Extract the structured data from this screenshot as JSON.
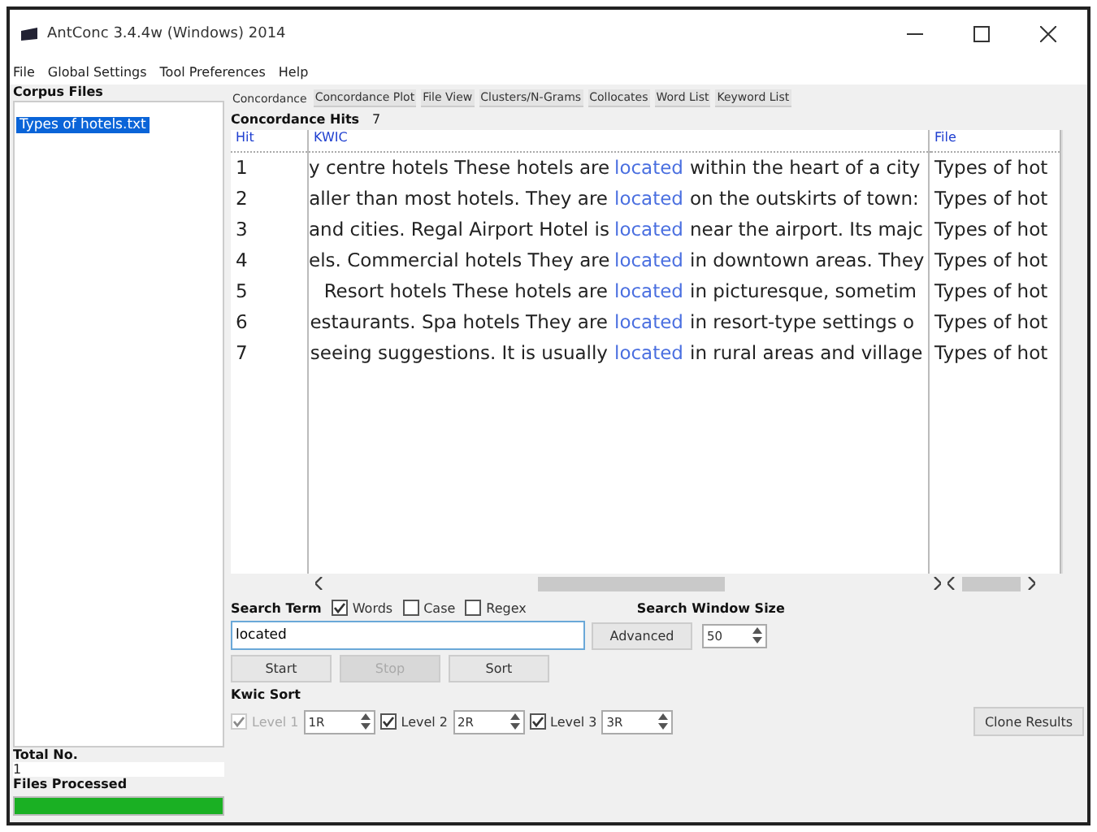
{
  "window": {
    "title": "AntConc 3.4.4w (Windows) 2014"
  },
  "menu": [
    "File",
    "Global Settings",
    "Tool Preferences",
    "Help"
  ],
  "corpus": {
    "heading": "Corpus Files",
    "files": [
      {
        "name": "Types of hotels.txt",
        "selected": true
      }
    ],
    "total_label": "Total No.",
    "total": "1",
    "processed_label": "Files Processed",
    "level": 1
  },
  "tabs": [
    {
      "label": "Concordance",
      "selected": true
    },
    {
      "label": "Concordance Plot",
      "selected": false
    },
    {
      "label": "File View",
      "selected": false
    },
    {
      "label": "Clusters/N-Grams",
      "selected": false
    },
    {
      "label": "Collocates",
      "selected": false
    },
    {
      "label": "Word List",
      "selected": false
    },
    {
      "label": "Keyword List",
      "selected": false
    }
  ],
  "hits": {
    "label": "Concordance Hits",
    "count": "7"
  },
  "table": {
    "columns": [
      "Hit",
      "KWIC",
      "File"
    ],
    "rows": [
      {
        "hit": "1",
        "left": "y centre hotels These hotels are",
        "keyword": "located",
        "right": "within the heart of a city",
        "file": "Types of hot"
      },
      {
        "hit": "2",
        "left": "aller than most hotels. They are",
        "keyword": "located",
        "right": "on the outskirts of town:",
        "file": "Types of hot"
      },
      {
        "hit": "3",
        "left": "and cities. Regal Airport Hotel is",
        "keyword": "located",
        "right": "near the airport. Its majc",
        "file": "Types of hot"
      },
      {
        "hit": "4",
        "left": "els. Commercial hotels They are",
        "keyword": "located",
        "right": "in downtown areas. They",
        "file": "Types of hot"
      },
      {
        "hit": "5",
        "left": "Resort hotels  These hotels are",
        "keyword": "located",
        "right": "in picturesque, sometim",
        "file": "Types of hot"
      },
      {
        "hit": "6",
        "left": "estaurants. Spa hotels  They are",
        "keyword": "located",
        "right": "in resort-type settings o",
        "file": "Types of hot"
      },
      {
        "hit": "7",
        "left": "seeing suggestions. It is usually",
        "keyword": "located",
        "right": "in rural areas and village",
        "file": "Types of hot"
      }
    ]
  },
  "search": {
    "label": "Search Term",
    "options": [
      {
        "label": "Words",
        "checked": true
      },
      {
        "label": "Case",
        "checked": false
      },
      {
        "label": "Regex",
        "checked": false
      }
    ],
    "value": "located",
    "advanced": "Advanced",
    "window_label": "Search Window Size",
    "window_value": "50"
  },
  "buttons": [
    {
      "label": "Start",
      "disabled": false
    },
    {
      "label": "Stop",
      "disabled": true
    },
    {
      "label": "Sort",
      "disabled": false
    }
  ],
  "kwic_sort": {
    "label": "Kwic Sort",
    "levels": [
      {
        "label": "Level 1",
        "checked": true,
        "disabled": true,
        "value": "1R"
      },
      {
        "label": "Level 2",
        "checked": true,
        "disabled": false,
        "value": "2R"
      },
      {
        "label": "Level 3",
        "checked": true,
        "disabled": false,
        "value": "3R"
      }
    ]
  },
  "clone": "Clone Results"
}
